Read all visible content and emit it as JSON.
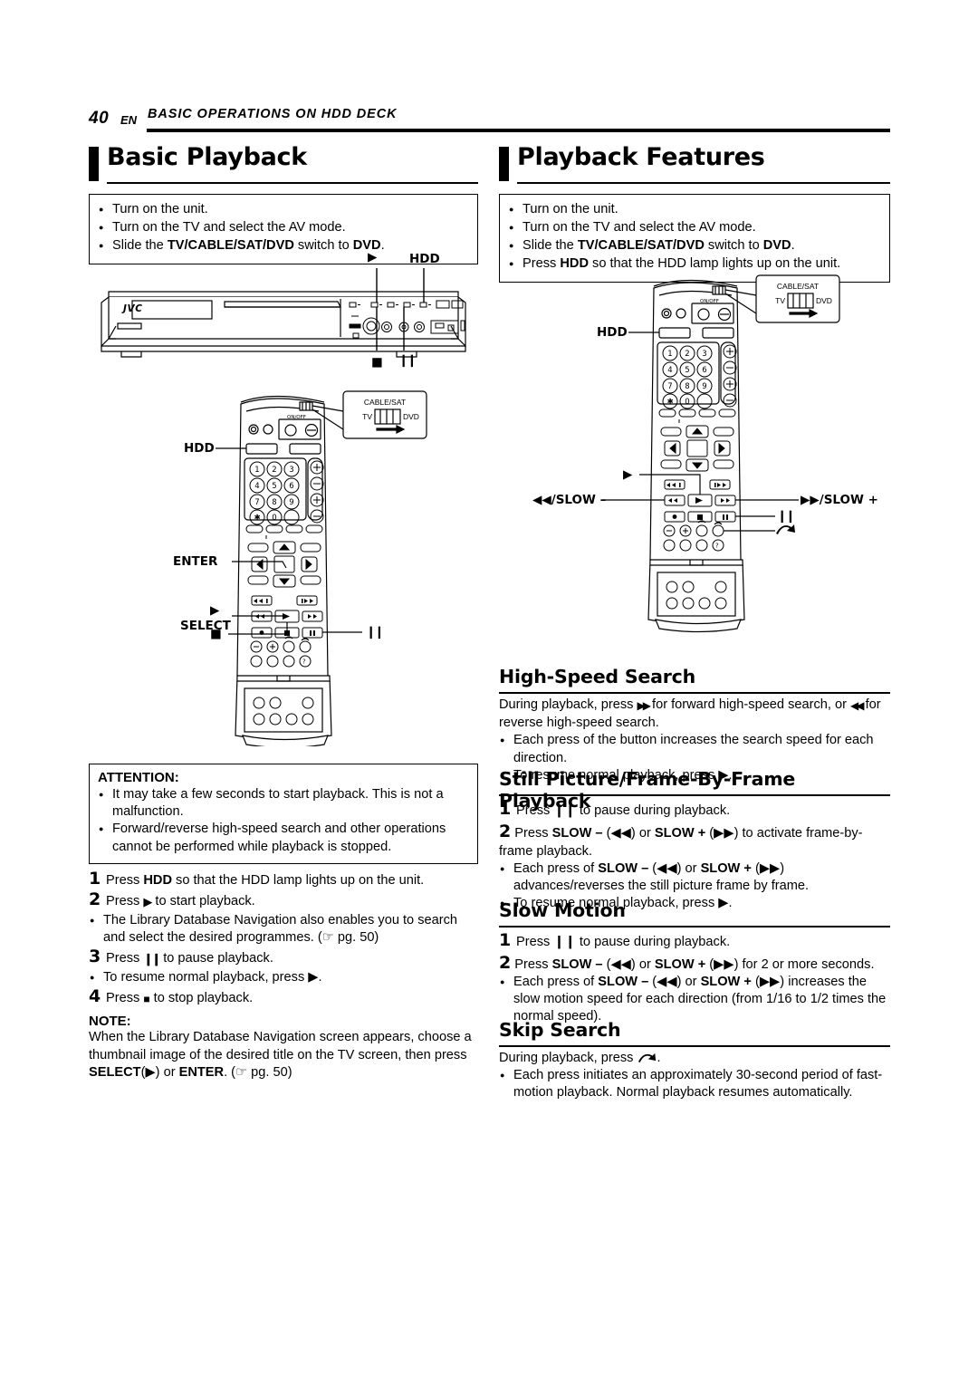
{
  "runhead": {
    "page_number": "40",
    "lang": "EN",
    "chapter": "BASIC OPERATIONS ON HDD DECK"
  },
  "left_column": {
    "section_title": "Basic Playback",
    "prep_box": {
      "items": [
        {
          "text_before": "Turn on the unit.",
          "bold1": "",
          "text_mid": "",
          "bold2": "",
          "text_after": ""
        },
        {
          "text_before": "Turn on the TV and select the AV mode.",
          "bold1": "",
          "text_mid": "",
          "bold2": "",
          "text_after": ""
        },
        {
          "text_before": "Slide the ",
          "bold1": "TV/CABLE/SAT/DVD",
          "text_mid": " switch to ",
          "bold2": "DVD",
          "text_after": "."
        }
      ]
    },
    "unit_figure": {
      "brand": "JVC",
      "callouts": {
        "play": "▶",
        "hdd": "HDD",
        "stop": "■",
        "pause": "❙❙"
      }
    },
    "remote_figure": {
      "switch_callout": {
        "top": "CABLE/SAT",
        "left": "TV",
        "right": "DVD"
      },
      "labels": {
        "hdd": "HDD",
        "enter": "ENTER",
        "play": "▶",
        "select": "SELECT",
        "stop": "■",
        "pause": "❙❙"
      },
      "keypad": [
        "1",
        "2",
        "3",
        "4",
        "5",
        "6",
        "7",
        "8",
        "9",
        "✶",
        "0",
        ""
      ]
    },
    "attention": {
      "title": "ATTENTION:",
      "items": [
        "It may take a few seconds to start playback. This is not a malfunction.",
        "Forward/reverse high-speed search and other operations cannot be performed while playback is stopped."
      ]
    },
    "steps": [
      {
        "num": "1",
        "parts": [
          "Press ",
          "HDD",
          " so that the HDD lamp lights up on the unit."
        ]
      },
      {
        "num": "2",
        "parts": [
          "Press ",
          "▶",
          " to start playback."
        ]
      },
      {
        "num": "3",
        "parts": [
          "Press ",
          "❙❙",
          " to pause playback."
        ]
      },
      {
        "num": "4",
        "parts": [
          "Press ",
          "■",
          " to stop playback."
        ]
      }
    ],
    "step2_bullet": "The Library Database Navigation also enables you to search and select the desired programmes. (☞ pg. 50)",
    "step3_bullet": "To resume normal playback, press ▶.",
    "note": {
      "title": "NOTE:",
      "body_1": "When the Library Database Navigation screen appears, choose a thumbnail image of the desired title on the TV screen, then press ",
      "bold_1": "SELECT",
      "body_2": "(▶) or ",
      "bold_2": "ENTER",
      "body_3": ". (☞ pg. 50)"
    }
  },
  "right_column": {
    "section_title": "Playback Features",
    "prep_box": {
      "items": [
        {
          "text_before": "Turn on the unit.",
          "bold1": "",
          "text_mid": "",
          "bold2": "",
          "text_after": ""
        },
        {
          "text_before": "Turn on the TV and select the AV mode.",
          "bold1": "",
          "text_mid": "",
          "bold2": "",
          "text_after": ""
        },
        {
          "text_before": "Slide the ",
          "bold1": "TV/CABLE/SAT/DVD",
          "text_mid": " switch to ",
          "bold2": "DVD",
          "text_after": "."
        },
        {
          "text_before": "Press ",
          "bold1": "HDD",
          "text_mid": " so that the HDD lamp lights up on the unit.",
          "bold2": "",
          "text_after": ""
        }
      ]
    },
    "remote_figure": {
      "switch_callout": {
        "top": "CABLE/SAT",
        "left": "TV",
        "right": "DVD"
      },
      "labels": {
        "hdd": "HDD",
        "play": "▶",
        "rew_slow_minus": "◀◀/SLOW –",
        "ff_slow_plus": "▶▶/SLOW +",
        "pause": "❙❙",
        "skip": "skip-arrow-icon"
      },
      "keypad": [
        "1",
        "2",
        "3",
        "4",
        "5",
        "6",
        "7",
        "8",
        "9",
        "✶",
        "0",
        ""
      ]
    },
    "high_speed_search": {
      "title": "High-Speed Search",
      "intro_1": "During playback, press ",
      "intro_ff": "▶▶",
      "intro_2": " for forward high-speed search, or ",
      "intro_rew": "◀◀",
      "intro_3": " for reverse high-speed search.",
      "bullets": [
        "Each press of the button increases the search speed for each direction.",
        "To resume normal playback, press ▶."
      ]
    },
    "still_picture": {
      "title": "Still Picture/Frame-By-Frame Playback",
      "step1": {
        "num": "1",
        "text": "Press ❙❙ to pause during playback."
      },
      "step2": {
        "num": "2",
        "a": "Press ",
        "b": "SLOW –",
        "c": " (◀◀) or ",
        "d": "SLOW +",
        "e": " (▶▶) to activate frame-by-frame playback."
      },
      "bullets": [
        {
          "a": "Each press of ",
          "b": "SLOW –",
          "c": " (◀◀) or ",
          "d": "SLOW +",
          "e": " (▶▶) advances/reverses the still picture frame by frame."
        },
        {
          "a": "To resume normal playback, press ▶.",
          "b": "",
          "c": "",
          "d": "",
          "e": ""
        }
      ]
    },
    "slow_motion": {
      "title": "Slow Motion",
      "step1": {
        "num": "1",
        "text": "Press ❙❙ to pause during playback."
      },
      "step2": {
        "num": "2",
        "a": "Press ",
        "b": "SLOW –",
        "c": " (◀◀) or ",
        "d": "SLOW +",
        "e": " (▶▶) for 2 or more seconds."
      },
      "bullet": {
        "a": "Each press of ",
        "b": "SLOW –",
        "c": " (◀◀) or ",
        "d": "SLOW +",
        "e": " (▶▶) increases the slow motion speed for each direction (from 1/16 to 1/2 times the normal speed)."
      }
    },
    "skip_search": {
      "title": "Skip Search",
      "intro": "During playback, press ",
      "intro_icon": "skip-arrow-icon",
      "intro_end": ".",
      "bullet": "Each press initiates an approximately 30-second period of fast-motion playback. Normal playback resumes automatically."
    }
  }
}
